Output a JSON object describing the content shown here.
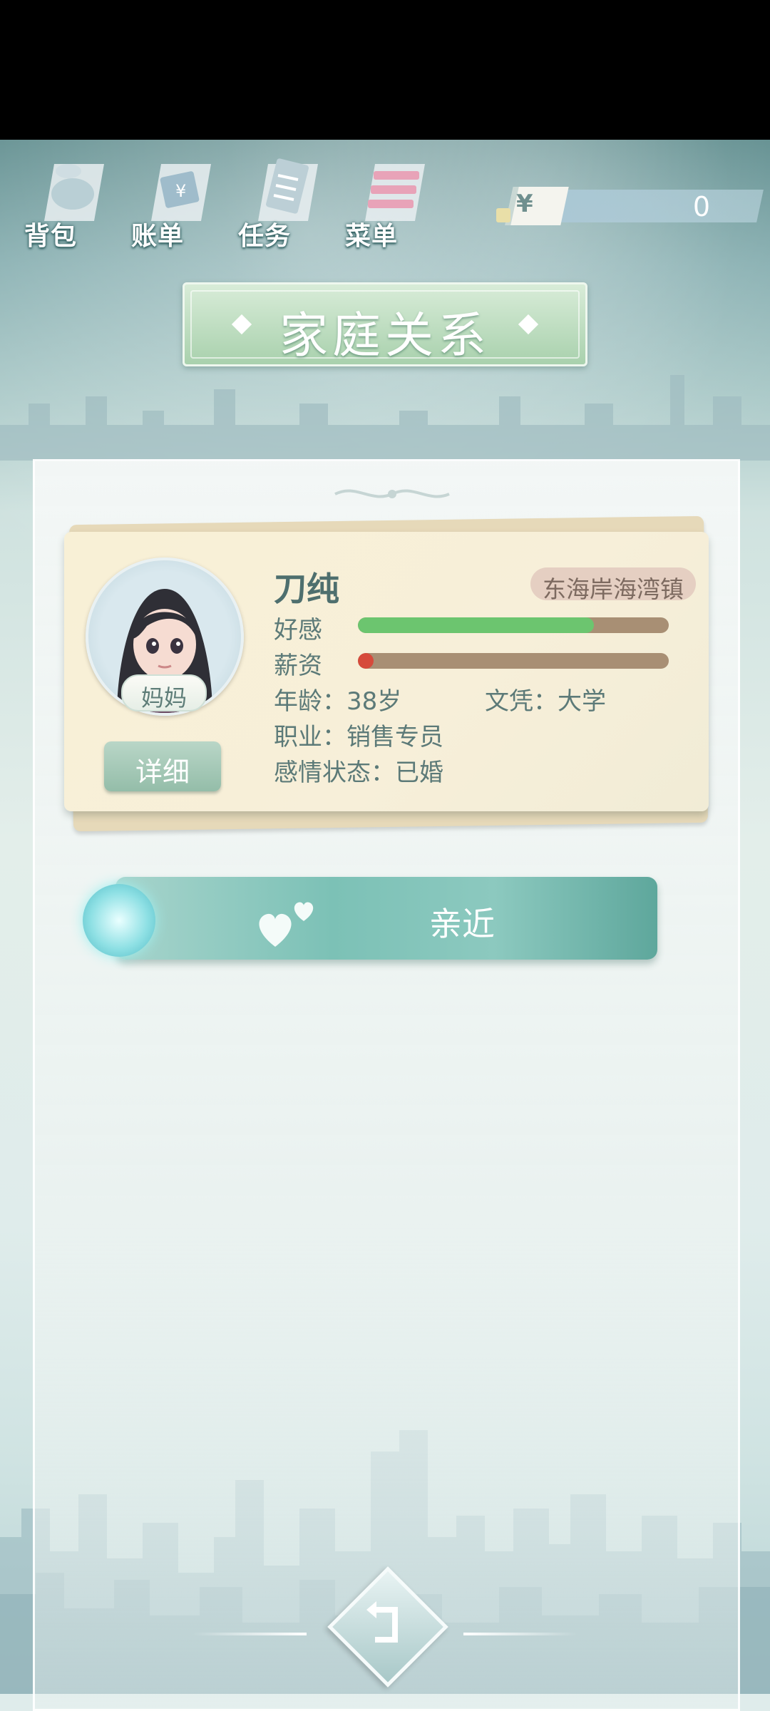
{
  "toolbar": {
    "items": [
      {
        "label": "背包",
        "icon": "bag-icon"
      },
      {
        "label": "账单",
        "icon": "bill-icon"
      },
      {
        "label": "任务",
        "icon": "task-icon"
      },
      {
        "label": "菜单",
        "icon": "menu-icon"
      }
    ]
  },
  "money": {
    "symbol": "¥",
    "value": "0"
  },
  "title": "家庭关系",
  "member": {
    "name": "刀纯",
    "role": "妈妈",
    "location": "东海岸海湾镇",
    "favor_label": "好感",
    "favor_fraction": 0.76,
    "salary_label": "薪资",
    "salary_fraction": 0.05,
    "age": "年龄：38岁",
    "education": "文凭：大学",
    "occupation": "职业：销售专员",
    "relationship": "感情状态：已婚",
    "detail_button": "详细"
  },
  "actions": {
    "approach": "亲近"
  },
  "colors": {
    "favor": "#6cc56f",
    "salary": "#d64a3b",
    "track": "#a88f74",
    "accent": "#7cc1b6"
  }
}
